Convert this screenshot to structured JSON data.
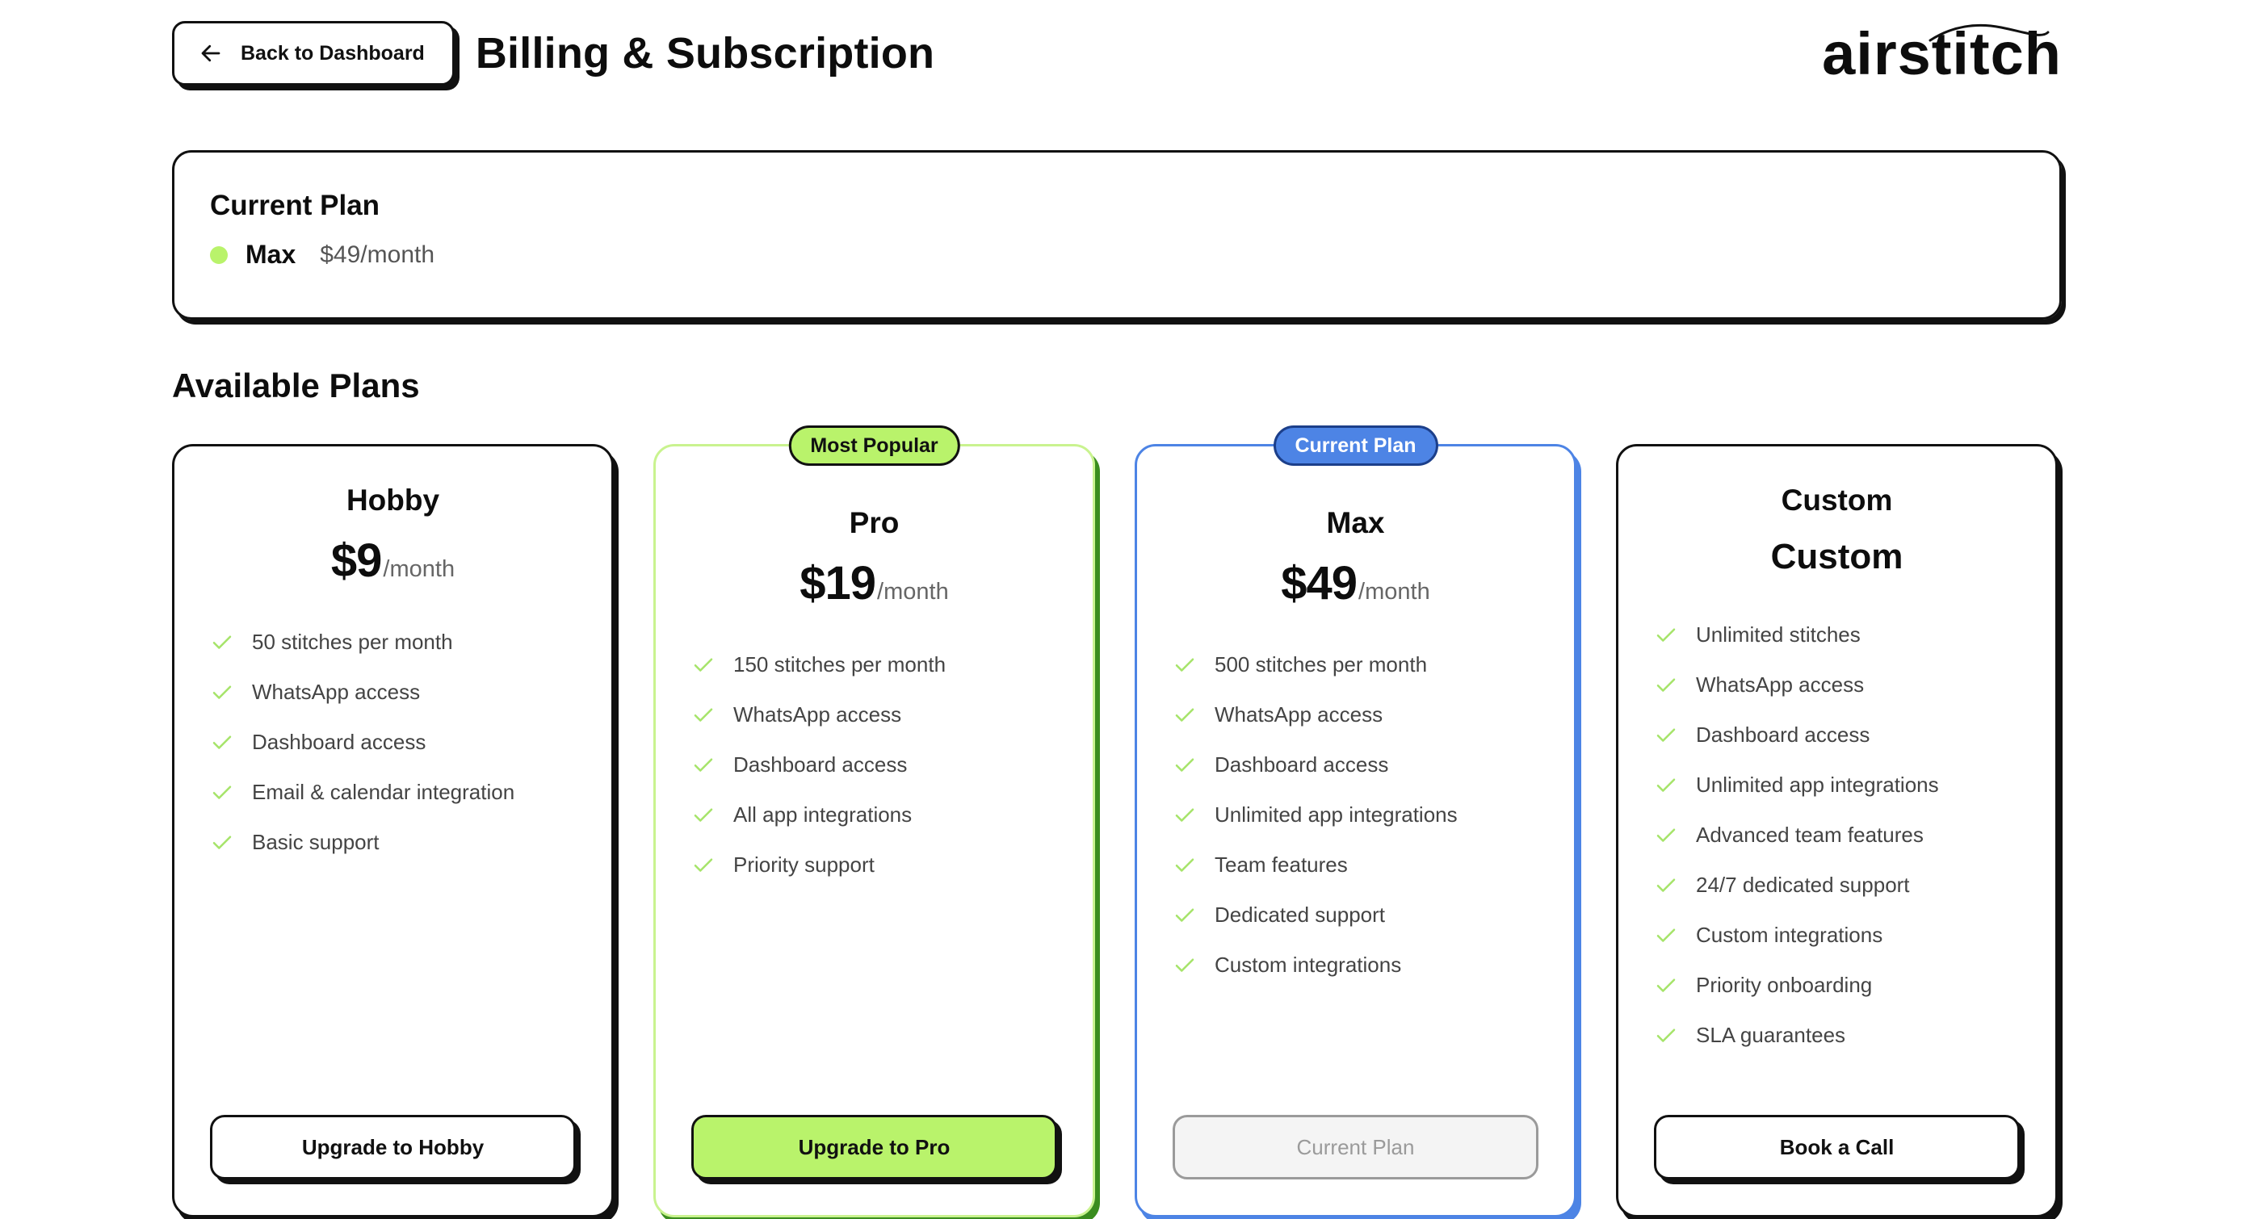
{
  "header": {
    "back_label": "Back to Dashboard",
    "title": "Billing & Subscription",
    "logo": "airstitch"
  },
  "current_plan": {
    "title": "Current Plan",
    "name": "Max",
    "price": "$49/month",
    "status_color": "#b9f36b"
  },
  "available_title": "Available Plans",
  "plans": [
    {
      "name": "Hobby",
      "price": "$9",
      "unit": "/month",
      "features": [
        "50 stitches per month",
        "WhatsApp access",
        "Dashboard access",
        "Email & calendar integration",
        "Basic support"
      ],
      "button": "Upgrade to Hobby"
    },
    {
      "badge": "Most Popular",
      "name": "Pro",
      "price": "$19",
      "unit": "/month",
      "features": [
        "150 stitches per month",
        "WhatsApp access",
        "Dashboard access",
        "All app integrations",
        "Priority support"
      ],
      "button": "Upgrade to Pro"
    },
    {
      "badge": "Current Plan",
      "name": "Max",
      "price": "$49",
      "unit": "/month",
      "features": [
        "500 stitches per month",
        "WhatsApp access",
        "Dashboard access",
        "Unlimited app integrations",
        "Team features",
        "Dedicated support",
        "Custom integrations"
      ],
      "button": "Current Plan"
    },
    {
      "name": "Custom",
      "price_text": "Custom",
      "features": [
        "Unlimited stitches",
        "WhatsApp access",
        "Dashboard access",
        "Unlimited app integrations",
        "Advanced team features",
        "24/7 dedicated support",
        "Custom integrations",
        "Priority onboarding",
        "SLA guarantees"
      ],
      "button": "Book a Call"
    }
  ],
  "colors": {
    "accent_green": "#b9f36b",
    "accent_blue": "#4d84e5",
    "check_green": "#a6e46a"
  },
  "icons": {
    "back": "arrow-left-icon",
    "feature": "check-icon"
  }
}
